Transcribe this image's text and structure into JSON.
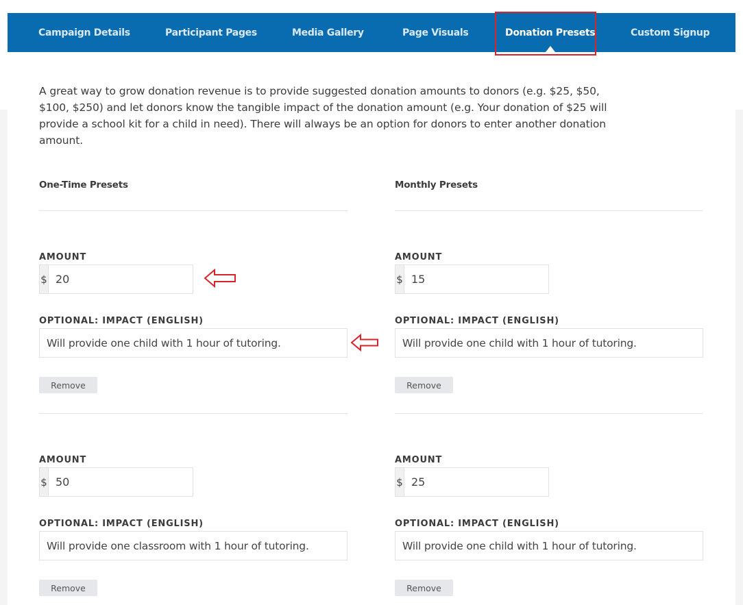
{
  "tabs": [
    {
      "label": "Campaign Details"
    },
    {
      "label": "Participant Pages"
    },
    {
      "label": "Media Gallery"
    },
    {
      "label": "Page Visuals"
    },
    {
      "label": "Donation Presets",
      "active": true
    },
    {
      "label": "Custom Signup"
    }
  ],
  "intro": "A great way to grow donation revenue is to provide suggested donation amounts to donors (e.g. $25, $50, $100, $250) and let donors know the tangible impact of the donation amount (e.g. Your donation of $25 will provide a school kit for a child in need). There will always be an option for donors to enter another donation amount.",
  "one_time": {
    "title": "One-Time Presets",
    "presets": [
      {
        "amount_label": "AMOUNT",
        "currency": "$",
        "amount": "20",
        "impact_label": "OPTIONAL: IMPACT (ENGLISH)",
        "impact": "Will provide one child with 1 hour of tutoring.",
        "remove_label": "Remove"
      },
      {
        "amount_label": "AMOUNT",
        "currency": "$",
        "amount": "50",
        "impact_label": "OPTIONAL: IMPACT (ENGLISH)",
        "impact": "Will provide one classroom with 1 hour of tutoring.",
        "remove_label": "Remove"
      }
    ]
  },
  "monthly": {
    "title": "Monthly Presets",
    "presets": [
      {
        "amount_label": "AMOUNT",
        "currency": "$",
        "amount": "15",
        "impact_label": "OPTIONAL: IMPACT (ENGLISH)",
        "impact": "Will provide one child with 1 hour of tutoring.",
        "remove_label": "Remove"
      },
      {
        "amount_label": "AMOUNT",
        "currency": "$",
        "amount": "25",
        "impact_label": "OPTIONAL: IMPACT (ENGLISH)",
        "impact": "Will provide one child with 1 hour of tutoring.",
        "remove_label": "Remove"
      }
    ]
  },
  "colors": {
    "nav_bg": "#0a6cb0",
    "highlight": "#d8232a",
    "annotation_arrow": "#d8232a"
  },
  "annotations": {
    "arrow_icon": "left-arrow-outline-icon"
  }
}
